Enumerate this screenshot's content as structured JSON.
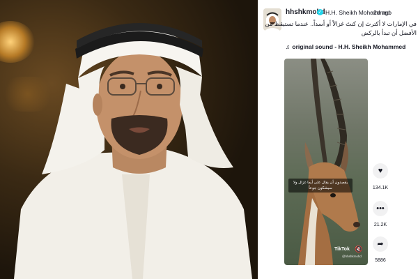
{
  "photo": {
    "icon": "portrait-photo"
  },
  "post": {
    "username": "hhshkmohd",
    "display_name": "H.H. Sheikh Mohammed",
    "separator": "·",
    "posted": "2d ago",
    "caption": "في الإمارات لا أكترث إن كنتَ غزالاً أو أسداً.. عندما تستيقظ من الأفضل أن تبدأ بالركض",
    "sound_label": "original sound - H.H. Sheikh Mohammed",
    "video": {
      "overlay_text": "يقصدون أن يقال على أيما غزال ولا سيشكون جوعاً",
      "watermark_logo": "TikTok",
      "watermark_handle": "@hhshkmohd"
    },
    "actions": {
      "likes": "134.1K",
      "comments": "21.2K",
      "shares": "5886"
    }
  },
  "colors": {
    "verified": "#20d5ec",
    "text": "#161823",
    "action_bg": "#f1f1f2"
  }
}
